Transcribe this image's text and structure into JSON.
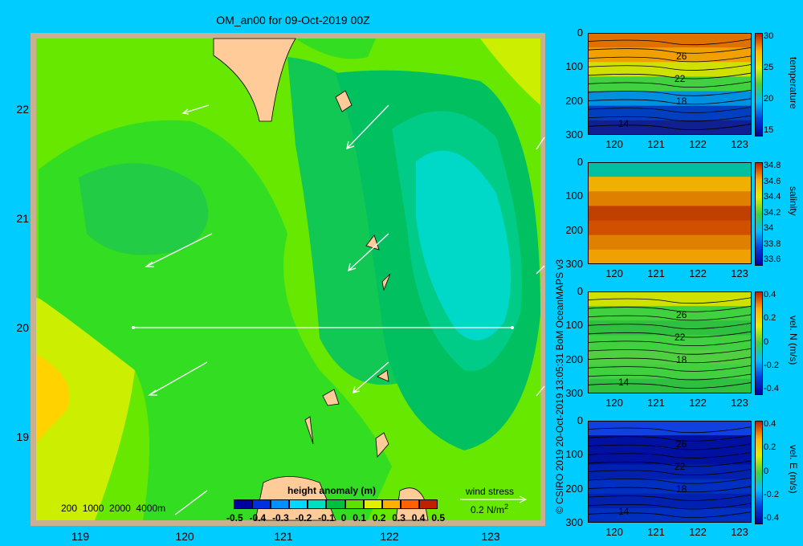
{
  "title": "OM_an00 for 09-Oct-2019 00Z",
  "map": {
    "lat_ticks": [
      "22",
      "21",
      "20",
      "19"
    ],
    "lon_ticks": [
      "119",
      "120",
      "121",
      "122",
      "123"
    ],
    "depth_legend": "200  1000  2000  4000m",
    "colorbar": {
      "title": "height anomaly  (m)",
      "labels": [
        "-0.5",
        "-0.4",
        "-0.3",
        "-0.2",
        "-0.1",
        "0",
        "0.1",
        "0.2",
        "0.3",
        "0.4",
        "0.5"
      ],
      "colors": [
        "#0000a0",
        "#0030e0",
        "#0090ff",
        "#00d8ff",
        "#00e0c0",
        "#00c040",
        "#60e000",
        "#e0f000",
        "#ffb000",
        "#ff6000",
        "#c02000"
      ]
    },
    "wind": {
      "title": "wind stress",
      "value": "0.2 N/m",
      "superscript": "2"
    },
    "colors": {
      "ocean_deep": "#00cc55",
      "ocean_mid": "#33dd22",
      "ocean_light": "#77ee00",
      "land": "#ffcc99",
      "coast": "#c8b090"
    }
  },
  "credit": "© CSIRO 2019   20-Oct-2019 13:05:31 BoM OceanMAPS v3",
  "panels": [
    {
      "label": "temperature",
      "cb_labels": [
        "30",
        "25",
        "20",
        "15"
      ],
      "contours": [
        "26",
        "22",
        "18",
        "14"
      ]
    },
    {
      "label": "salinity",
      "cb_labels": [
        "34.8",
        "34.6",
        "34.4",
        "34.2",
        "34",
        "33.8",
        "33.6"
      ],
      "contours": []
    },
    {
      "label": "vel. N (m/s)",
      "cb_labels": [
        "0.4",
        "0.2",
        "0",
        "-0.2",
        "-0.4"
      ],
      "contours": [
        "26",
        "22",
        "18",
        "14"
      ]
    },
    {
      "label": "vel. E (m/s)",
      "cb_labels": [
        "0.4",
        "0.2",
        "0",
        "-0.2",
        "-0.4"
      ],
      "contours": [
        "26",
        "22",
        "18",
        "14"
      ]
    }
  ],
  "panel_y_ticks": [
    "0",
    "100",
    "200",
    "300"
  ],
  "panel_x_ticks": [
    "120",
    "121",
    "122",
    "123"
  ]
}
